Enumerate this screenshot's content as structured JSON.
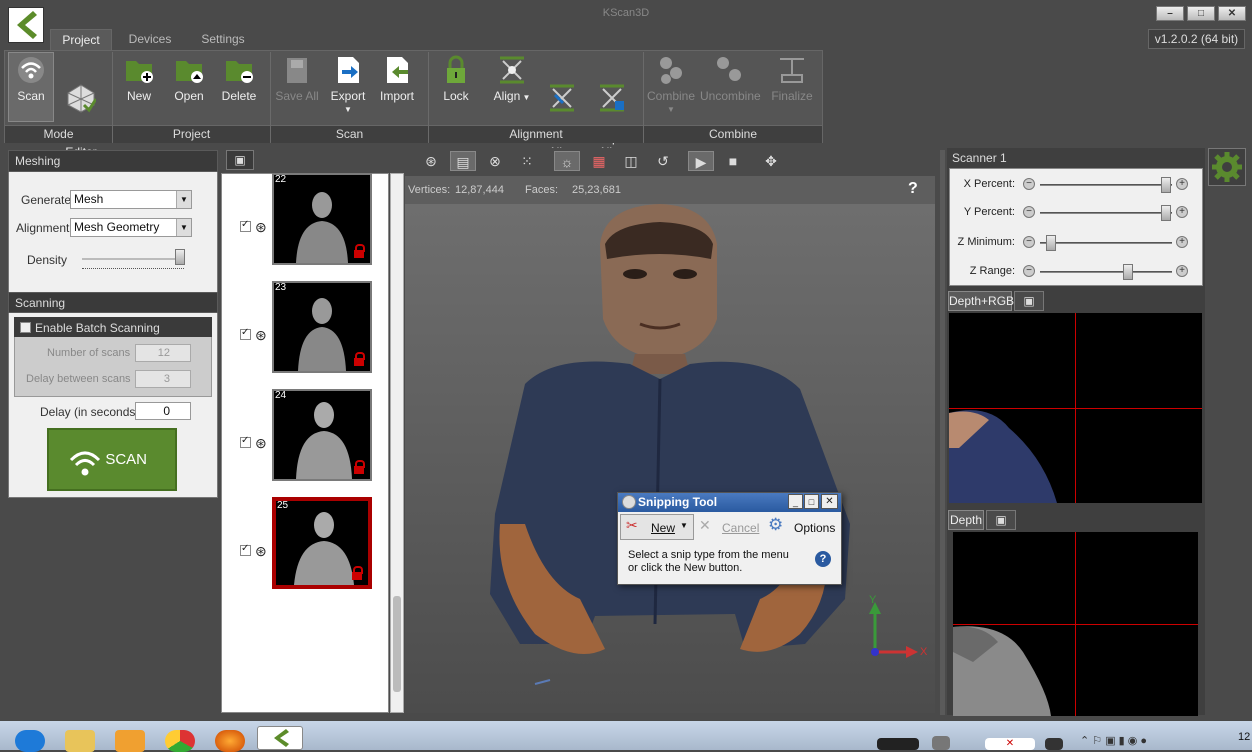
{
  "app": {
    "title": "KScan3D",
    "version": "v1.2.0.2  (64 bit)"
  },
  "tabs": [
    "Project",
    "Devices",
    "Settings"
  ],
  "ribbon": {
    "mode": [
      "Scan",
      "Mesh\nEditor"
    ],
    "project": [
      "New",
      "Open",
      "Delete"
    ],
    "scan": [
      "Save All",
      "Export",
      "Import"
    ],
    "alignment": [
      "Lock",
      "Align",
      "Undo\nAlign",
      "Repeat\nAlign"
    ],
    "combine": [
      "Combine",
      "Uncombine",
      "Finalize"
    ],
    "groups": [
      "Mode",
      "Project",
      "Scan",
      "Alignment",
      "Combine"
    ]
  },
  "meshing": {
    "title": "Meshing",
    "generate_label": "Generate",
    "generate_value": "Mesh",
    "alignment_label": "Alignment",
    "alignment_value": "Mesh Geometry",
    "density_label": "Density"
  },
  "scanning": {
    "title": "Scanning",
    "batch_label": "Enable Batch Scanning",
    "num_scans_label": "Number of scans",
    "num_scans_value": "12",
    "delay_between_label": "Delay between scans",
    "delay_between_value": "3",
    "delay_label": "Delay (in seconds)",
    "delay_value": "0",
    "scan_button": "SCAN"
  },
  "thumbnails": [
    {
      "num": "22"
    },
    {
      "num": "23"
    },
    {
      "num": "24"
    },
    {
      "num": "25"
    }
  ],
  "viewport": {
    "vertices_label": "Vertices:",
    "vertices_value": "12,87,444",
    "faces_label": "Faces:",
    "faces_value": "25,23,681",
    "help": "?",
    "axis_y": "Y",
    "axis_x": "X"
  },
  "scanner": {
    "title": "Scanner 1",
    "sliders": [
      {
        "label": "X Percent:",
        "value": 0.95
      },
      {
        "label": "Y Percent:",
        "value": 0.95
      },
      {
        "label": "Z Minimum:",
        "value": 0.05
      },
      {
        "label": "Z Range:",
        "value": 0.65
      }
    ],
    "view1_tab": "Depth+RGB",
    "view2_tab": "Depth"
  },
  "snipping": {
    "title": "Snipping Tool",
    "new_label": "New",
    "cancel_label": "Cancel",
    "options_label": "Options",
    "message": "Select a snip type from the menu or click the New button."
  },
  "taskbar": {
    "clock": "12"
  },
  "colors": {
    "accent_green": "#5a8a2e",
    "selected_red": "#aa0000",
    "panel_bg": "#f0f0f0",
    "viewport_top": "#707070",
    "viewport_bottom": "#4c4c4c"
  }
}
